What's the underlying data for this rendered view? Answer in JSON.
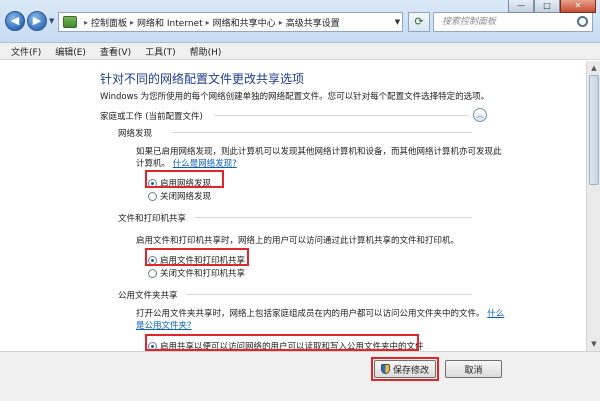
{
  "address_bar": {
    "breadcrumbs": [
      "控制面板",
      "网络和 Internet",
      "网络和共享中心",
      "高级共享设置"
    ],
    "search_placeholder": "搜索控制面板"
  },
  "menu": [
    "文件(F)",
    "编辑(E)",
    "查看(V)",
    "工具(T)",
    "帮助(H)"
  ],
  "page": {
    "title": "针对不同的网络配置文件更改共享选项",
    "intro": "Windows 为您所使用的每个网络创建单独的网络配置文件。您可以针对每个配置文件选择特定的选项。",
    "profile_heading": "家庭或工作 (当前配置文件)"
  },
  "sections": {
    "discovery": {
      "heading": "网络发现",
      "desc_line1": "如果已启用网络发现，则此计算机可以发现其他网络计算机和设备，而其他网络计算机亦可发现此",
      "desc_line2": "计算机。",
      "link": "什么是网络发现?",
      "opt_on": "启用网络发现",
      "opt_off": "关闭网络发现"
    },
    "file_printer": {
      "heading": "文件和打印机共享",
      "desc": "启用文件和打印机共享时，网络上的用户可以访问通过此计算机共享的文件和打印机。",
      "opt_on": "启用文件和打印机共享",
      "opt_off": "关闭文件和打印机共享"
    },
    "public_folder": {
      "heading": "公用文件夹共享",
      "desc_line1": "打开公用文件夹共享时，网络上包括家庭组成员在内的用户都可以访问公用文件夹中的文件。",
      "link_part1": "什么",
      "link_part2": "是公用文件夹?",
      "opt_on": "启用共享以便可以访问网络的用户可以读取和写入公用文件夹中的文件"
    }
  },
  "buttons": {
    "save": "保存修改",
    "cancel": "取消"
  }
}
